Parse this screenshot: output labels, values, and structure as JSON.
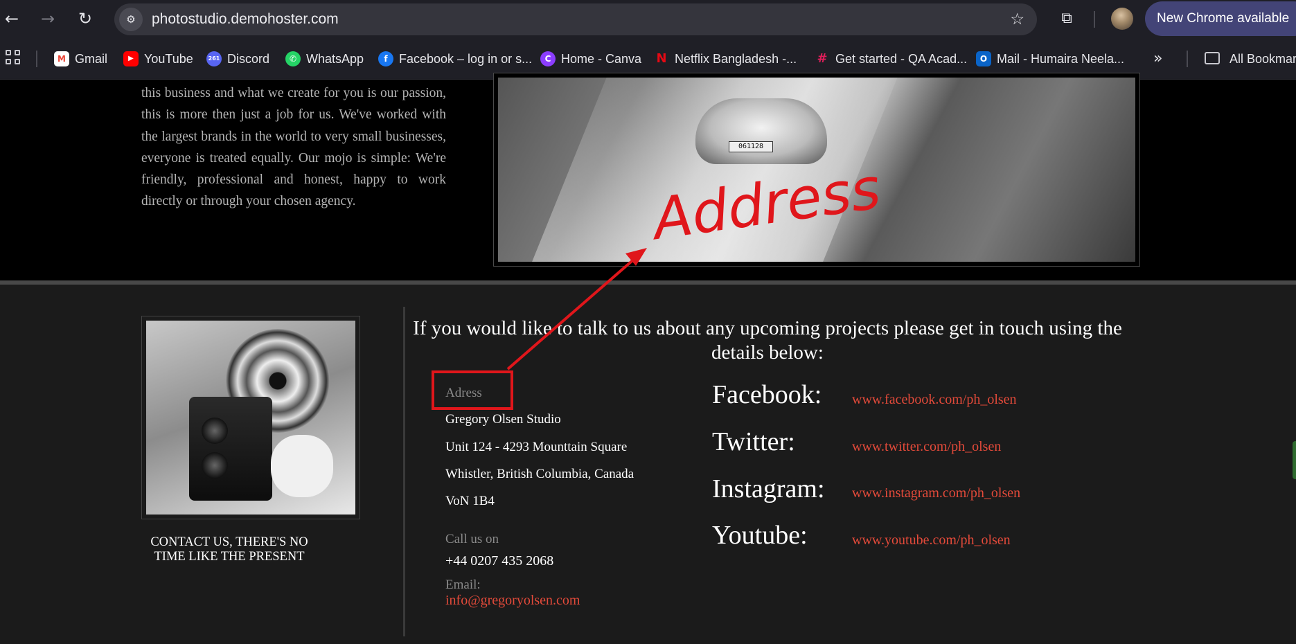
{
  "browser": {
    "url": "photostudio.demohoster.com",
    "update_label": "New Chrome available",
    "bookmarks": [
      {
        "label": "Gmail",
        "icon": "gmail-icon",
        "glyph": "M",
        "color": "#ea4335"
      },
      {
        "label": "YouTube",
        "icon": "youtube-icon",
        "glyph": "▶",
        "color": "#ff0000"
      },
      {
        "label": "Discord",
        "icon": "discord-icon",
        "glyph": "261",
        "color": "#5865f2"
      },
      {
        "label": "WhatsApp",
        "icon": "whatsapp-icon",
        "glyph": "✆",
        "color": "#25d366"
      },
      {
        "label": "Facebook – log in or s...",
        "icon": "facebook-icon",
        "glyph": "f",
        "color": "#1877f2"
      },
      {
        "label": "Home - Canva",
        "icon": "canva-icon",
        "glyph": "C",
        "color": "#8b3dff"
      },
      {
        "label": "Netflix Bangladesh -...",
        "icon": "netflix-icon",
        "glyph": "N",
        "color": "#e50914"
      },
      {
        "label": "Get started - QA Acad...",
        "icon": "slack-icon",
        "glyph": "#",
        "color": "#e01e5a"
      },
      {
        "label": "Mail - Humaira Neela...",
        "icon": "outlook-icon",
        "glyph": "O",
        "color": "#0a64c8"
      }
    ],
    "all_bookmarks_label": "All Bookmarks"
  },
  "about": {
    "text": "this business and what we create for you is our passion, this is more then just a job for us. We've worked with the largest brands in the world to very small businesses, everyone is treated equally. Our mojo is simple: We're friendly, professional and honest, happy to work directly or through your chosen agency."
  },
  "hero": {
    "plate": "061128"
  },
  "footer": {
    "cta": "CONTACT US, THERE'S NO TIME LIKE THE PRESENT",
    "heading": "If you would like to talk to us about any upcoming projects please get in touch using the details below:",
    "address_label": "Adress",
    "address_lines": [
      "Gregory Olsen Studio",
      "Unit 124 - 4293 Mounttain Square",
      "Whistler, British Columbia, Canada",
      "VoN 1B4"
    ],
    "call_label": "Call us on",
    "phone": "+44 0207 435 2068",
    "email_label": "Email:",
    "email": "info@gregoryolsen.com",
    "social": [
      {
        "name": "Facebook:",
        "url": "www.facebook.com/ph_olsen"
      },
      {
        "name": "Twitter:",
        "url": "www.twitter.com/ph_olsen"
      },
      {
        "name": "Instagram:",
        "url": "www.instagram.com/ph_olsen"
      },
      {
        "name": "Youtube:",
        "url": "www.youtube.com/ph_olsen"
      }
    ]
  },
  "annotation": {
    "text": "Address",
    "color": "#e0161b"
  }
}
